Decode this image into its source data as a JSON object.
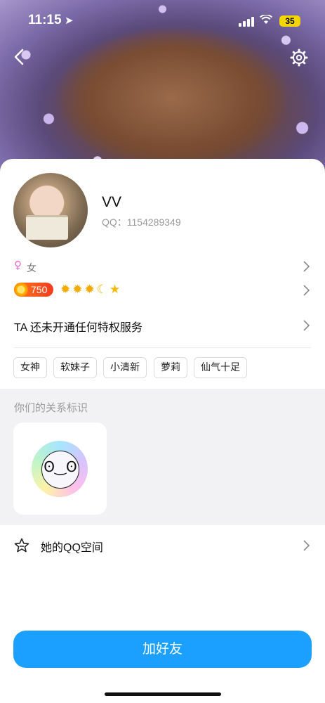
{
  "status_bar": {
    "time": "11:15",
    "battery": "35"
  },
  "colors": {
    "accent": "#1ba0ff",
    "gender": "#e36bd0",
    "level_badge": "#f23b1f"
  },
  "header": {
    "back_icon": "chevron-left-icon",
    "settings_icon": "gear-icon"
  },
  "profile": {
    "nickname": "VV",
    "qq_label": "QQ：1154289349",
    "gender_symbol": "♀",
    "gender": "女",
    "level": "750",
    "level_icons": [
      "sun",
      "sun",
      "sun",
      "moon",
      "star"
    ],
    "privilege_text": "TA 还未开通任何特权服务"
  },
  "tags": [
    "女神",
    "软妹子",
    "小清新",
    "萝莉",
    "仙气十足"
  ],
  "relationship": {
    "title": "你们的关系标识"
  },
  "qzone": {
    "label": "她的QQ空间"
  },
  "actions": {
    "add_friend": "加好友"
  }
}
